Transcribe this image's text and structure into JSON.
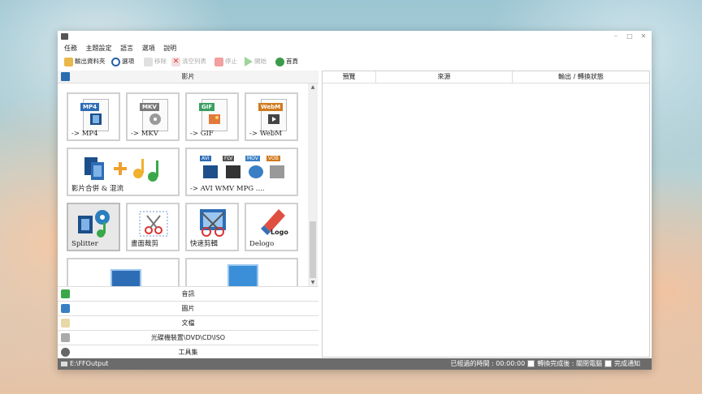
{
  "menu": [
    "任務",
    "主題設定",
    "語言",
    "選項",
    "說明"
  ],
  "toolbar": {
    "output_folder": "輸出資料夾",
    "options": "選項",
    "remove": "移除",
    "clear_list": "清空列表",
    "stop": "停止",
    "start": "開始",
    "home": "首頁"
  },
  "left": {
    "video_header": "影片",
    "tiles": [
      {
        "tag": "MP4",
        "label": "-> MP4",
        "tag_color": "#2d6db5"
      },
      {
        "tag": "MKV",
        "label": "-> MKV",
        "tag_color": "#7a7a7a"
      },
      {
        "tag": "GIF",
        "label": "-> GIF",
        "tag_color": "#3a9e5f"
      },
      {
        "tag": "WebM",
        "label": "-> WebM",
        "tag_color": "#d07a1e"
      }
    ],
    "merge_label": "影片合併 & 混流",
    "multi_label": "-> AVI WMV MPG ....",
    "multi_tags": [
      "AVI",
      "FLV",
      "MOV",
      "VOB"
    ],
    "tools": [
      {
        "label": "Splitter"
      },
      {
        "label": "畫面裁剪"
      },
      {
        "label": "快速剪輯"
      },
      {
        "label": "Delogo"
      }
    ],
    "delogo_text": "Logo",
    "categories": [
      "音訊",
      "圖片",
      "文檔",
      "光碟機裝置\\DVD\\CD\\ISO",
      "工具集"
    ]
  },
  "right": {
    "columns": [
      "預覽",
      "來源",
      "輸出 / 轉換狀態"
    ]
  },
  "status": {
    "output_path": "E:\\FFOutput",
    "elapsed": "已經過的時間 : 00:00:00",
    "after_done": "轉換完成後 : 關閉電腦",
    "notify": "完成通知"
  }
}
